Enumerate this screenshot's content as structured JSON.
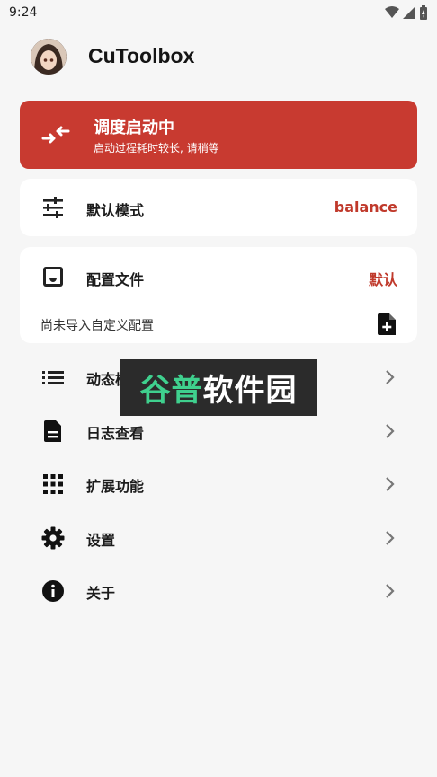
{
  "status_bar": {
    "time": "9:24"
  },
  "header": {
    "app_title": "CuToolbox"
  },
  "status_card": {
    "title": "调度启动中",
    "subtitle": "启动过程耗时较长, 请稍等",
    "color": "#c83a30"
  },
  "mode_card": {
    "label": "默认模式",
    "value": "balance",
    "icon": "tune-sliders-icon"
  },
  "config_card": {
    "label": "配置文件",
    "value": "默认",
    "subtitle": "尚未导入自定义配置",
    "icon": "inbox-icon",
    "action_icon": "note-add-icon"
  },
  "menu": [
    {
      "label": "动态模式",
      "icon": "list-icon"
    },
    {
      "label": "日志查看",
      "icon": "document-icon"
    },
    {
      "label": "扩展功能",
      "icon": "apps-grid-icon"
    },
    {
      "label": "设置",
      "icon": "gear-icon"
    },
    {
      "label": "关于",
      "icon": "info-icon"
    }
  ],
  "watermark": {
    "part1": "谷普",
    "part2": "软件园"
  },
  "accent_color": "#c0392b"
}
